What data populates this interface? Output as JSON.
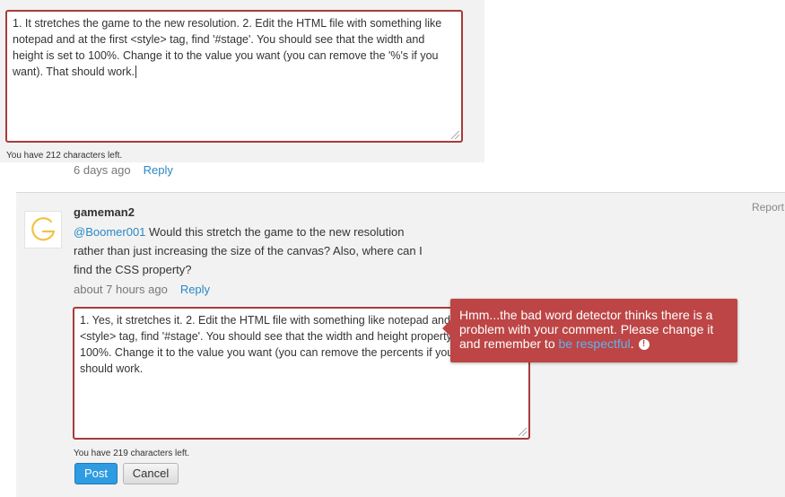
{
  "first_reply": {
    "textarea_text": "1. It stretches the game to the new resolution. 2. Edit the HTML file with something like notepad and at the first <style> tag, find '#stage'. You should see that the width and height is set to 100%. Change it to the value you want (you can remove the '%'s if you want). That should work.",
    "chars_left": "You have 212 characters left."
  },
  "parent_meta": {
    "time": "6 days ago",
    "reply_label": "Reply"
  },
  "comment": {
    "report_label": "Report",
    "username": "gameman2",
    "mention": "@Boomer001",
    "body": " Would this stretch the game to the new resolution rather than just increasing the size of the canvas? Also, where can I find the CSS property?",
    "time": "about 7 hours ago",
    "reply_label": "Reply",
    "avatar_icon": "logo-ring-icon"
  },
  "reply_form": {
    "textarea_text": "1. Yes, it stretches it. 2. Edit the HTML file with something like notepad and at the first <style> tag, find '#stage'. You should see that the width and height property is set to 100%. Change it to the value you want (you can remove the percents if you want). That should work.",
    "chars_left": "You have 219 characters left.",
    "post_label": "Post",
    "cancel_label": "Cancel"
  },
  "tooltip": {
    "text": "Hmm...the bad word detector thinks there is a problem with your comment. Please change it and remember to ",
    "link_text": "be respectful",
    "suffix": ".",
    "icon_glyph": "!",
    "icon": "alert-icon"
  },
  "colors": {
    "link": "#2a88c6",
    "error_border": "#a83b3b",
    "tooltip_bg": "#bd4545",
    "post_button": "#2f9be0"
  }
}
